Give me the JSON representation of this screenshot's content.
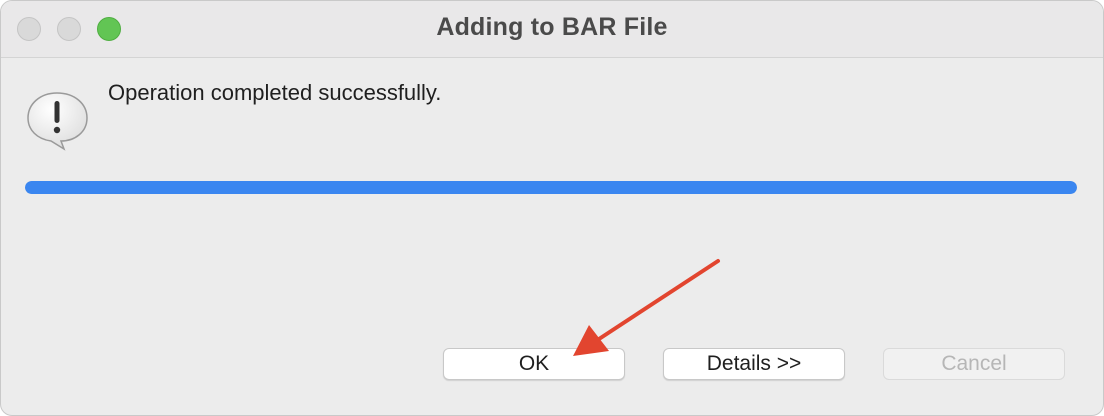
{
  "window": {
    "title": "Adding to BAR File"
  },
  "alert": {
    "icon": "exclamation-speech-bubble-icon",
    "message": "Operation completed successfully."
  },
  "progress": {
    "value_percent": 100,
    "color": "#3a86f0"
  },
  "buttons": {
    "ok": "OK",
    "details": "Details >>",
    "cancel": "Cancel",
    "cancel_enabled": false
  },
  "annotation": {
    "icon": "red-arrow-pointing-to-ok",
    "color": "#e2452f"
  }
}
